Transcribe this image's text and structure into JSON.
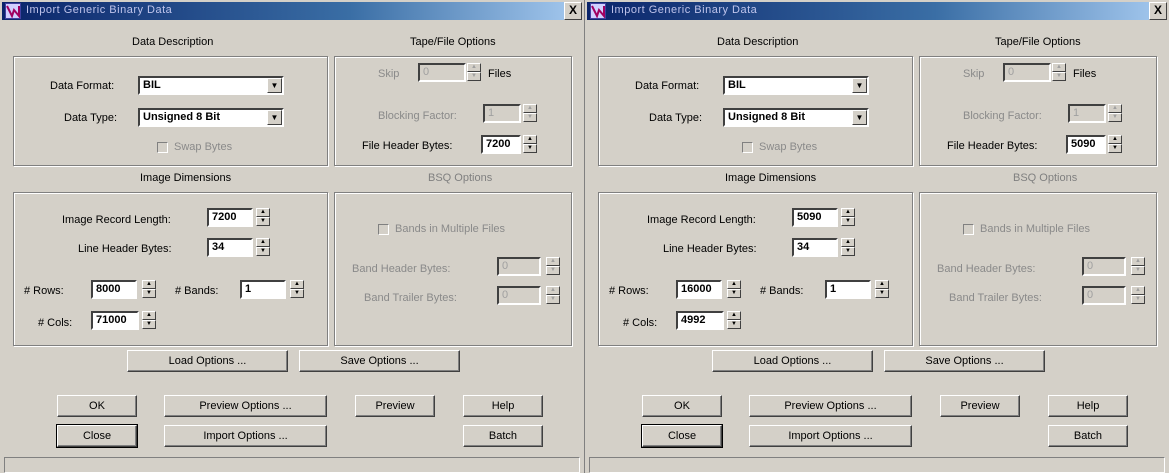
{
  "dialogs": [
    {
      "title": "Import Generic Binary Data",
      "close_glyph": "X",
      "sections": {
        "data_description": "Data Description",
        "tape_file_options": "Tape/File Options",
        "image_dimensions": "Image Dimensions",
        "bsq_options": "BSQ Options"
      },
      "data_format": {
        "label": "Data Format:",
        "value": "BIL"
      },
      "data_type": {
        "label": "Data Type:",
        "value": "Unsigned 8 Bit"
      },
      "swap_bytes": {
        "label": "Swap Bytes",
        "checked": false
      },
      "skip": {
        "label": "Skip",
        "value": "0",
        "suffix": "Files"
      },
      "blocking_factor": {
        "label": "Blocking Factor:",
        "value": "1"
      },
      "file_header_bytes": {
        "label": "File Header Bytes:",
        "value": "7200"
      },
      "image_record_length": {
        "label": "Image Record Length:",
        "value": "7200"
      },
      "line_header_bytes": {
        "label": "Line Header Bytes:",
        "value": "34"
      },
      "rows": {
        "label": "# Rows:",
        "value": "8000"
      },
      "bands": {
        "label": "# Bands:",
        "value": "1"
      },
      "cols": {
        "label": "# Cols:",
        "value": "71000"
      },
      "bands_in_multiple_files": {
        "label": "Bands in Multiple Files",
        "checked": false
      },
      "band_header_bytes": {
        "label": "Band Header Bytes:",
        "value": "0"
      },
      "band_trailer_bytes": {
        "label": "Band Trailer Bytes:",
        "value": "0"
      },
      "buttons": {
        "load_options": "Load Options ...",
        "save_options": "Save Options ...",
        "ok": "OK",
        "preview_options": "Preview Options ...",
        "preview": "Preview",
        "help": "Help",
        "close": "Close",
        "import_options": "Import Options ...",
        "batch": "Batch"
      }
    },
    {
      "title": "Import Generic Binary Data",
      "close_glyph": "X",
      "sections": {
        "data_description": "Data Description",
        "tape_file_options": "Tape/File Options",
        "image_dimensions": "Image Dimensions",
        "bsq_options": "BSQ Options"
      },
      "data_format": {
        "label": "Data Format:",
        "value": "BIL"
      },
      "data_type": {
        "label": "Data Type:",
        "value": "Unsigned 8 Bit"
      },
      "swap_bytes": {
        "label": "Swap Bytes",
        "checked": false
      },
      "skip": {
        "label": "Skip",
        "value": "0",
        "suffix": "Files"
      },
      "blocking_factor": {
        "label": "Blocking Factor:",
        "value": "1"
      },
      "file_header_bytes": {
        "label": "File Header Bytes:",
        "value": "5090"
      },
      "image_record_length": {
        "label": "Image Record Length:",
        "value": "5090"
      },
      "line_header_bytes": {
        "label": "Line Header Bytes:",
        "value": "34"
      },
      "rows": {
        "label": "# Rows:",
        "value": "16000"
      },
      "bands": {
        "label": "# Bands:",
        "value": "1"
      },
      "cols": {
        "label": "# Cols:",
        "value": "4992"
      },
      "bands_in_multiple_files": {
        "label": "Bands in Multiple Files",
        "checked": false
      },
      "band_header_bytes": {
        "label": "Band Header Bytes:",
        "value": "0"
      },
      "band_trailer_bytes": {
        "label": "Band Trailer Bytes:",
        "value": "0"
      },
      "buttons": {
        "load_options": "Load Options ...",
        "save_options": "Save Options ...",
        "ok": "OK",
        "preview_options": "Preview Options ...",
        "preview": "Preview",
        "help": "Help",
        "close": "Close",
        "import_options": "Import Options ...",
        "batch": "Batch"
      }
    }
  ]
}
